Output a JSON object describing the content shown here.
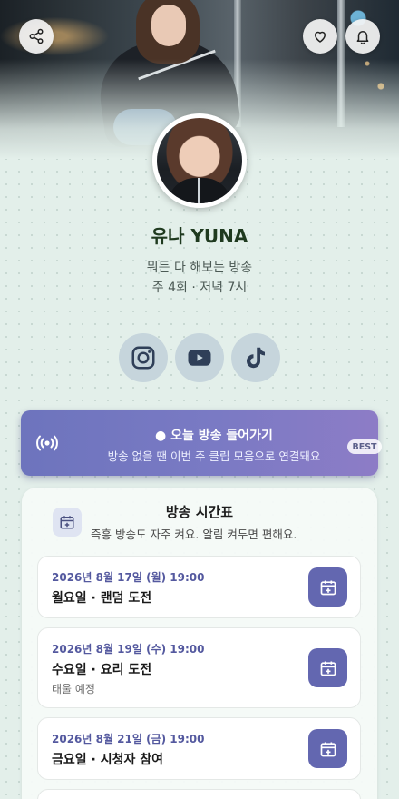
{
  "colors": {
    "accent": "#6367b0",
    "banner_start": "#6d74bd",
    "banner_end": "#8d7cc6",
    "name_color": "#1f3a1f",
    "date_color": "#54599f"
  },
  "header": {
    "share_icon": "share-icon",
    "heart_icon": "heart-icon",
    "bell_icon": "bell-icon"
  },
  "profile": {
    "name": "유나 YUNA",
    "tagline": "뭐든 다 해보는 방송",
    "schedule_summary": "주 4회 · 저녁 7시"
  },
  "social": [
    {
      "icon": "instagram-icon"
    },
    {
      "icon": "youtube-icon"
    },
    {
      "icon": "tiktok-icon"
    }
  ],
  "live_banner": {
    "title": "● 오늘 방송 들어가기",
    "subtitle": "방송 없을 땐 이번 주 클립 모음으로 연결돼요",
    "badge": "BEST",
    "icon": "broadcast-icon"
  },
  "schedule": {
    "title": "방송 시간표",
    "subtitle": "즉흥 방송도 자주 켜요. 알림 켜두면 편해요.",
    "icon": "calendar-add-icon",
    "events": [
      {
        "date": "2026년 8월 17일 (월) 19:00",
        "title": "월요일 · 랜덤 도전",
        "note": ""
      },
      {
        "date": "2026년 8월 19일 (수) 19:00",
        "title": "수요일 · 요리 도전",
        "note": "태울 예정"
      },
      {
        "date": "2026년 8월 21일 (금) 19:00",
        "title": "금요일 · 시청자 참여",
        "note": ""
      }
    ]
  }
}
